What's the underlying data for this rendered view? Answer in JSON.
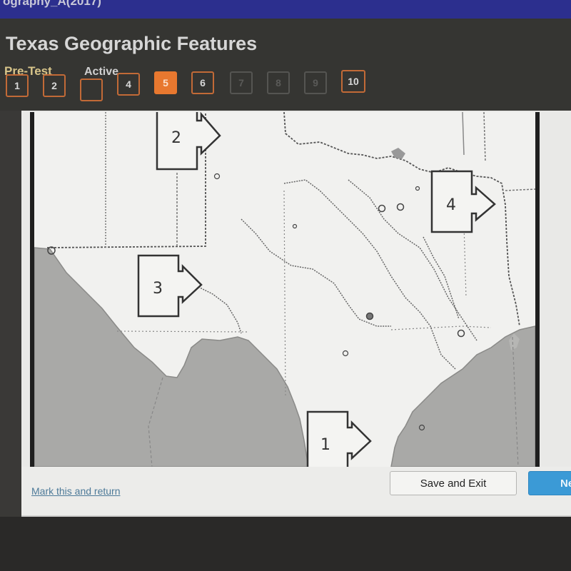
{
  "window": {
    "course_title": "ography_A(2017)"
  },
  "header": {
    "title": "Texas Geographic Features",
    "test_type": "Pre-Test",
    "status": "Active"
  },
  "questions": [
    {
      "label": "1",
      "state": "visited"
    },
    {
      "label": "2",
      "state": "visited"
    },
    {
      "label": "",
      "state": "visited"
    },
    {
      "label": "4",
      "state": "visited"
    },
    {
      "label": "5",
      "state": "current"
    },
    {
      "label": "6",
      "state": "visited"
    },
    {
      "label": "7",
      "state": "disabled"
    },
    {
      "label": "8",
      "state": "disabled"
    },
    {
      "label": "9",
      "state": "disabled"
    },
    {
      "label": "10",
      "state": "visited"
    }
  ],
  "map": {
    "subject": "Texas map",
    "pieces": [
      {
        "label": "1",
        "arrow": "right"
      },
      {
        "label": "2",
        "arrow": "right"
      },
      {
        "label": "3",
        "arrow": "right"
      },
      {
        "label": "4",
        "arrow": "right"
      }
    ]
  },
  "footer": {
    "mark_link": "Mark this and return",
    "save_button": "Save and Exit",
    "next_button": "Next"
  },
  "colors": {
    "accent_orange": "#e8782f",
    "next_blue": "#3b9ad6",
    "link_blue": "#4d7a99",
    "pretest_gold": "#d8c58a"
  }
}
